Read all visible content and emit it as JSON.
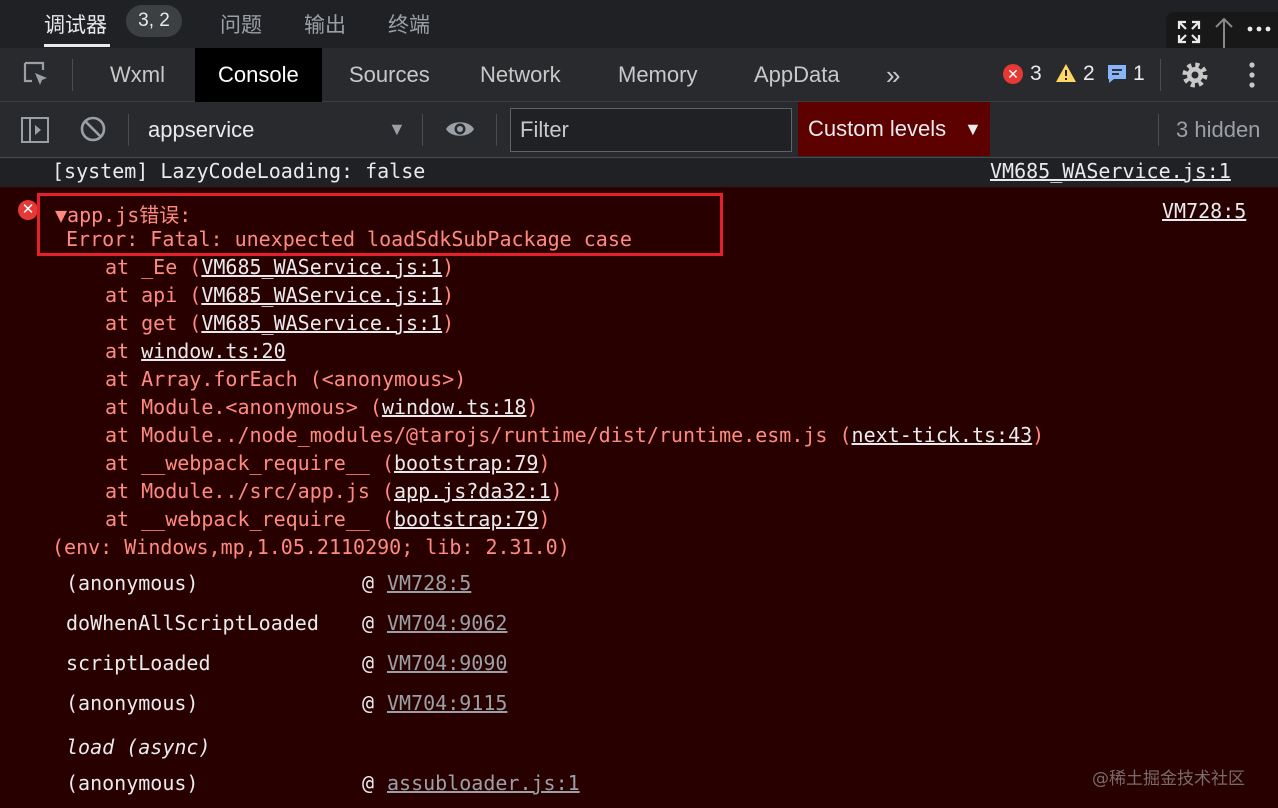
{
  "panel_tabs": [
    "调试器",
    "问题",
    "输出",
    "终端"
  ],
  "panel_badge": "3, 2",
  "devtools_tabs": [
    "Wxml",
    "Console",
    "Sources",
    "Network",
    "Memory",
    "AppData"
  ],
  "overflow_label": "»",
  "counts": {
    "errors": "3",
    "warnings": "2",
    "messages": "1"
  },
  "toolbar": {
    "context": "appservice",
    "filter_placeholder": "Filter",
    "levels": "Custom levels",
    "hidden": "3 hidden"
  },
  "system_row": {
    "text": "[system] LazyCodeLoading: false",
    "source": "VM685_WAService.js:1"
  },
  "error": {
    "title": "▼app.js错误:",
    "message": "Error: Fatal: unexpected loadSdkSubPackage case",
    "source": "VM728:5",
    "trace": [
      {
        "prefix": "at _Ee (",
        "link": "VM685_WAService.js:1",
        "suffix": ")"
      },
      {
        "prefix": "at api (",
        "link": "VM685_WAService.js:1",
        "suffix": ")"
      },
      {
        "prefix": "at get (",
        "link": "VM685_WAService.js:1",
        "suffix": ")"
      },
      {
        "prefix": "at ",
        "link": "window.ts:20",
        "suffix": ""
      },
      {
        "prefix": "at Array.forEach (<anonymous>)",
        "link": "",
        "suffix": ""
      },
      {
        "prefix": "at Module.<anonymous> (",
        "link": "window.ts:18",
        "suffix": ")"
      },
      {
        "prefix": "at Module../node_modules/@tarojs/runtime/dist/runtime.esm.js (",
        "link": "next-tick.ts:43",
        "suffix": ")"
      },
      {
        "prefix": "at __webpack_require__ (",
        "link": "bootstrap:79",
        "suffix": ")"
      },
      {
        "prefix": "at Module../src/app.js (",
        "link": "app.js?da32:1",
        "suffix": ")"
      },
      {
        "prefix": "at __webpack_require__ (",
        "link": "bootstrap:79",
        "suffix": ")"
      }
    ],
    "env": "(env: Windows,mp,1.05.2110290; lib: 2.31.0)"
  },
  "call_stack": [
    {
      "name": "(anonymous)",
      "at": "@",
      "link": "VM728:5"
    },
    {
      "name": "doWhenAllScriptLoaded",
      "at": "@",
      "link": "VM704:9062"
    },
    {
      "name": "scriptLoaded",
      "at": "@",
      "link": "VM704:9090"
    },
    {
      "name": "(anonymous)",
      "at": "@",
      "link": "VM704:9115"
    },
    {
      "name": "load (async)",
      "at": "",
      "link": ""
    },
    {
      "name": "(anonymous)",
      "at": "@",
      "link": "assubloader.js:1"
    }
  ],
  "watermark": "@稀土掘金技术社区",
  "colors": {
    "console_bg": "#290000",
    "error_text": "#ff8a80",
    "highlight": "#e6202a",
    "levels_bg": "#5c0000"
  }
}
